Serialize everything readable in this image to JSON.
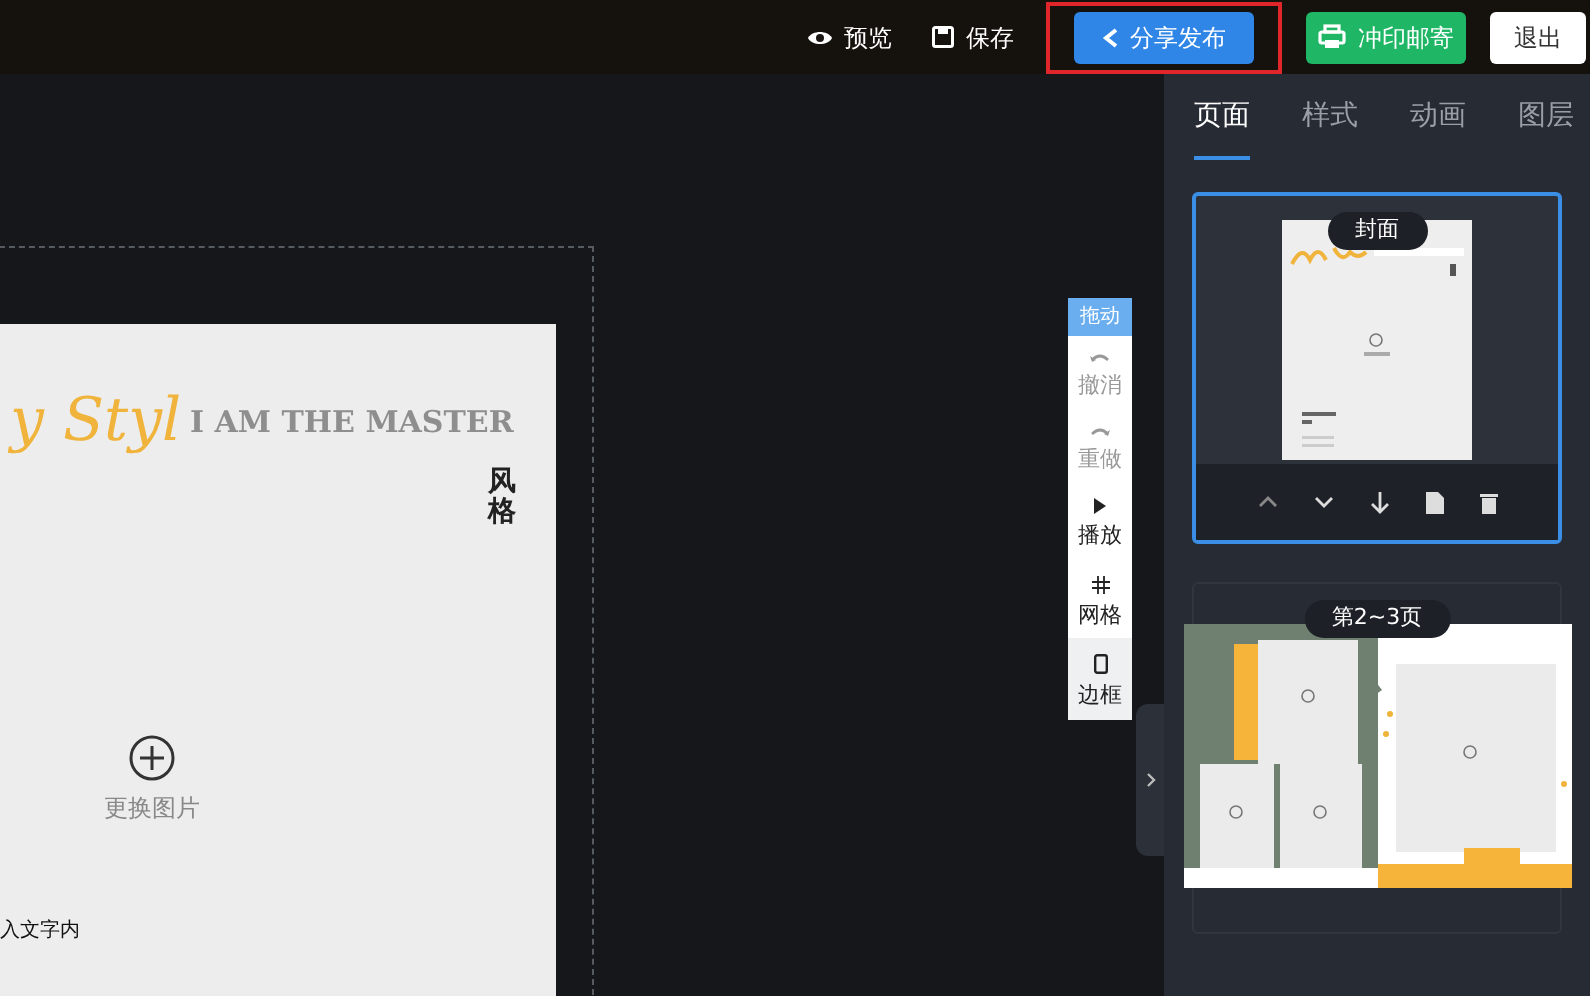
{
  "top_bar": {
    "buttons": [
      {
        "kind": "preview",
        "label": "预览"
      },
      {
        "kind": "save",
        "label": "保存"
      },
      {
        "kind": "share",
        "label": "分享发布",
        "highlighted": true
      },
      {
        "kind": "print",
        "label": "冲印邮寄"
      },
      {
        "kind": "exit",
        "label": "退出"
      }
    ]
  },
  "canvas": {
    "script_title": "y Styl",
    "headline": "I AM THE MASTER",
    "vertical_text": "风格",
    "image_slot": {
      "label": "更换图片"
    },
    "text_box": "入文字内"
  },
  "toolbar": {
    "header": "拖动",
    "items": [
      {
        "kind": "undo",
        "label": "撤消",
        "disabled": true,
        "selected": false
      },
      {
        "kind": "redo",
        "label": "重做",
        "disabled": true,
        "selected": false
      },
      {
        "kind": "play",
        "label": "播放",
        "disabled": false,
        "selected": false
      },
      {
        "kind": "grid",
        "label": "网格",
        "disabled": false,
        "selected": false
      },
      {
        "kind": "border",
        "label": "边框",
        "disabled": false,
        "selected": true
      }
    ]
  },
  "side_panel": {
    "tabs": [
      {
        "label": "页面",
        "selected": true
      },
      {
        "label": "样式",
        "selected": false
      },
      {
        "label": "动画",
        "selected": false
      },
      {
        "label": "图层",
        "selected": false
      }
    ],
    "pages": [
      {
        "kind": "cover",
        "label": "封面",
        "selected": true
      },
      {
        "kind": "spread",
        "label": "第2~3页",
        "selected": false
      }
    ]
  }
}
